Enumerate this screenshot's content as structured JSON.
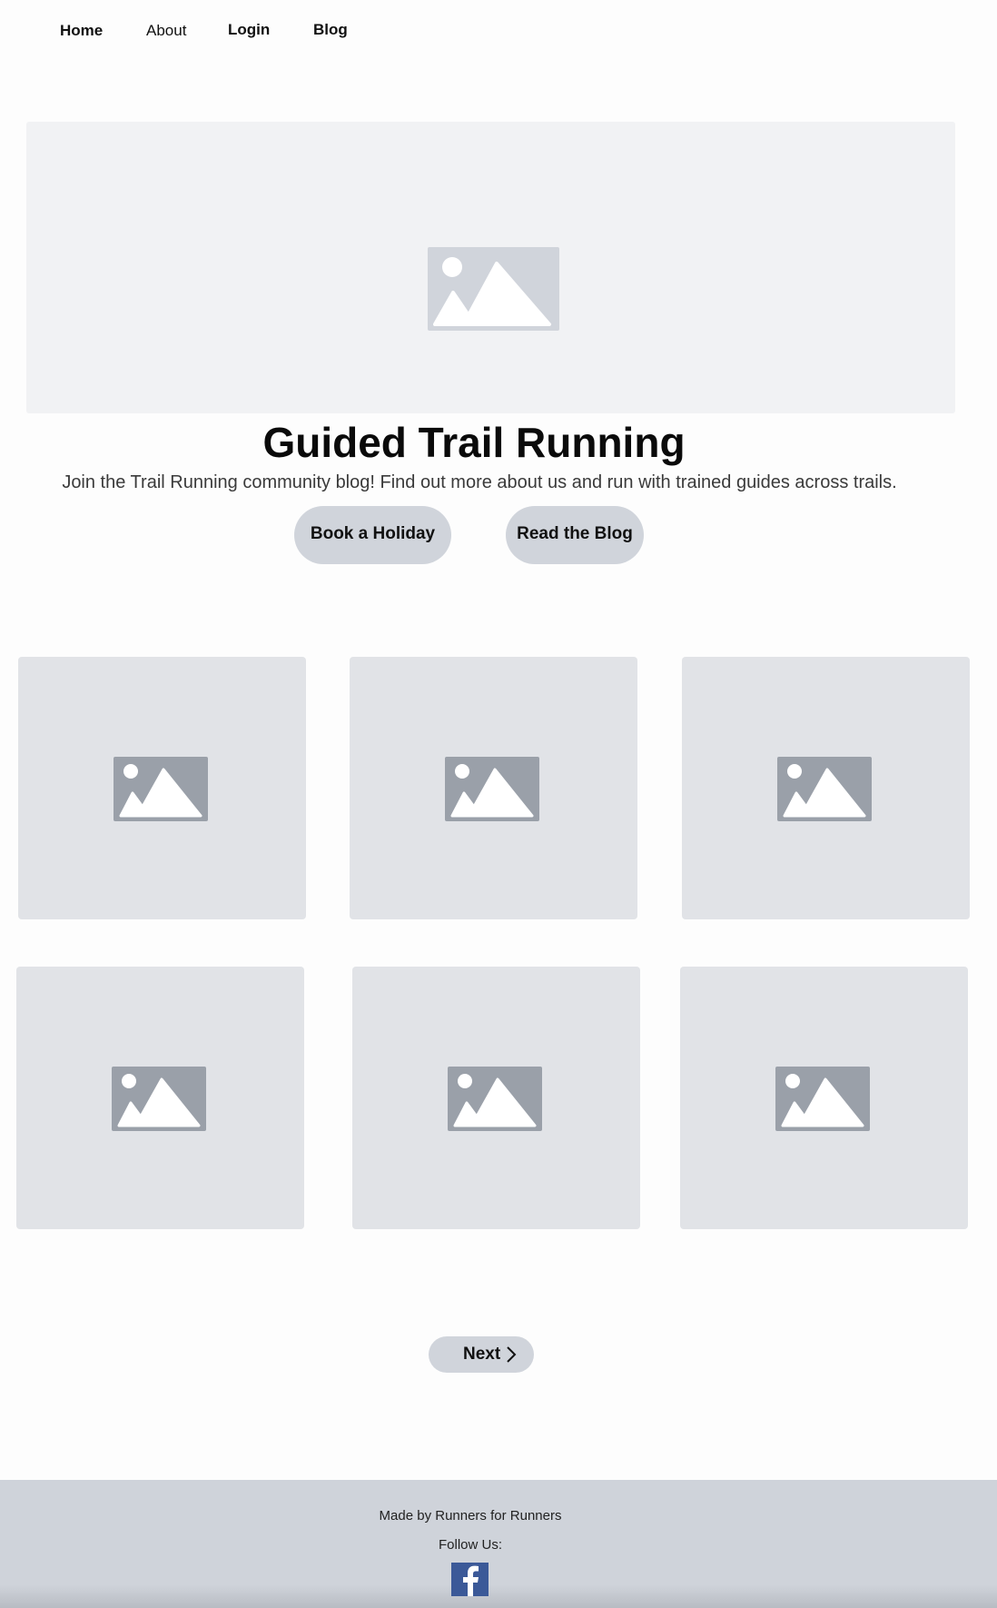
{
  "nav": {
    "items": [
      {
        "label": "Home"
      },
      {
        "label": "About"
      },
      {
        "label": "Login"
      },
      {
        "label": "Blog"
      }
    ]
  },
  "hero": {
    "title": "Guided Trail Running",
    "subtitle": "Join the Trail Running community blog! Find out more about us and run with trained guides across trails.",
    "buttons": {
      "book": "Book a Holiday",
      "blog": "Read the Blog"
    }
  },
  "gallery": {
    "cards": 6
  },
  "pagination": {
    "next_label": "Next"
  },
  "footer": {
    "made_by": "Made by Runners for Runners",
    "follow": "Follow Us:",
    "social_icon": "facebook-icon"
  },
  "colors": {
    "hero_bg": "#f1f2f4",
    "card_bg": "#e1e3e7",
    "button_bg": "#d0d4db",
    "footer_bg": "#cfd3da",
    "facebook": "#3b5998"
  }
}
